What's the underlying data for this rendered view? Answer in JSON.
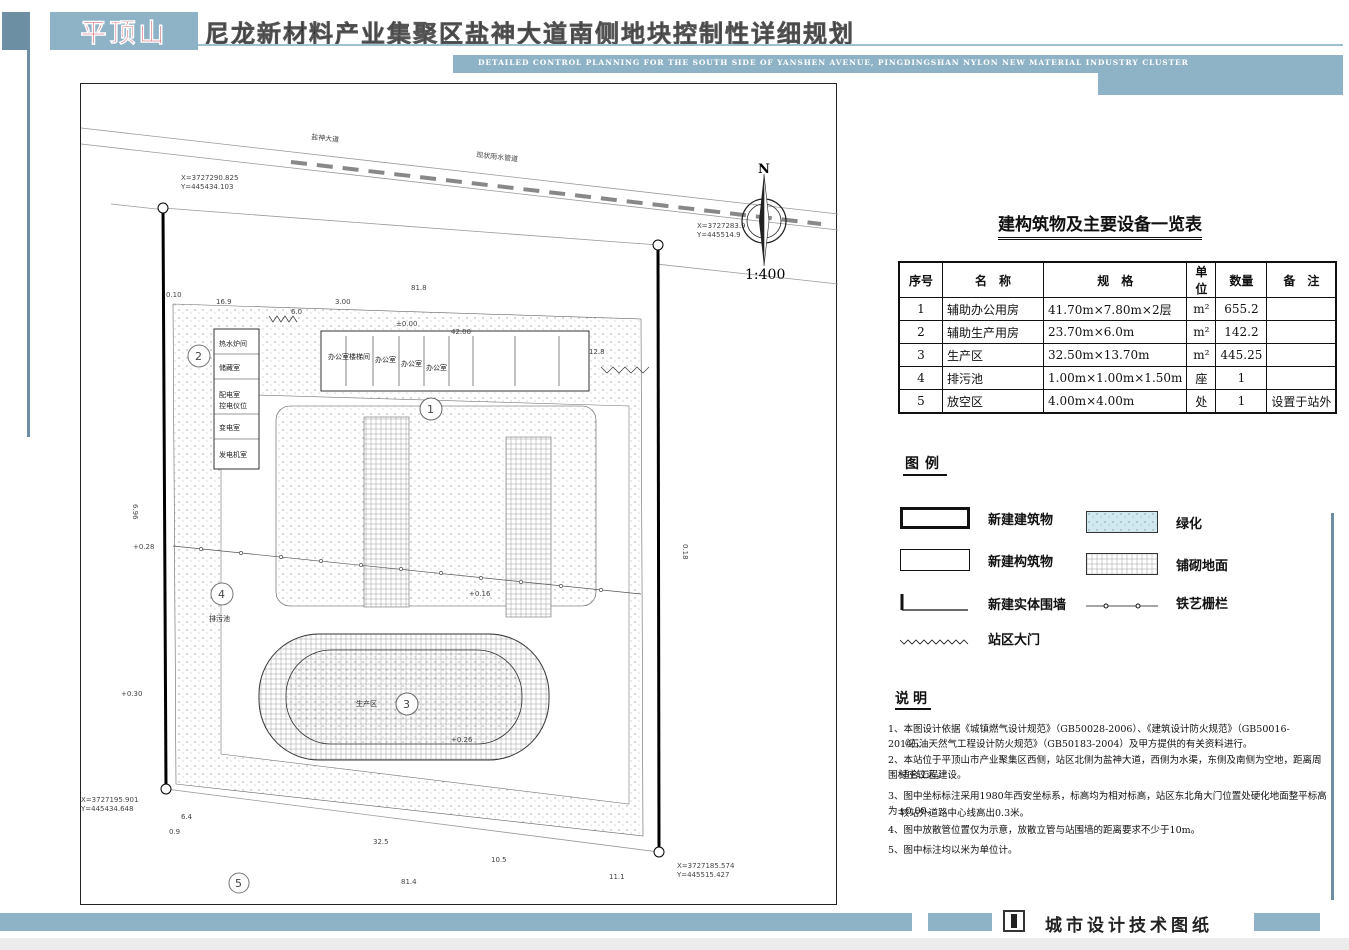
{
  "header": {
    "city": "平顶山",
    "title": "尼龙新材料产业集聚区盐神大道南侧地块控制性详细规划",
    "subtitle_en": "DETAILED CONTROL PLANNING FOR THE SOUTH SIDE OF YANSHEN AVENUE, PINGDINGSHAN NYLON NEW MATERIAL INDUSTRY CLUSTER"
  },
  "drawing": {
    "road_name": "盐神大道",
    "pipe_label": "现状雨水管道",
    "north": "N",
    "scale": "1:400",
    "coord_nw_x": "X=3727290.825",
    "coord_nw_y": "Y=445434.103",
    "coord_ne_x": "X=3727283.9",
    "coord_ne_y": "Y=445514.9",
    "coord_sw_x": "X=3727195.901",
    "coord_sw_y": "Y=445434.648",
    "coord_se_x": "X=3727185.574",
    "coord_se_y": "Y=445515.427",
    "rooms": [
      "热水炉间",
      "储藏室",
      "配电室",
      "控电仪位",
      "变电室",
      "发电机室"
    ],
    "office_rooms": [
      "办公室",
      "楼梯间",
      "办公室",
      "办公室",
      "办公室"
    ],
    "production_label": "生产区",
    "sewage_label": "排污池",
    "dims": {
      "top_total": "81.8",
      "d16_9": "16.9",
      "d6_0": "6.0",
      "d3_00": "3.00",
      "d42_00": "42.00",
      "d0_10": "0.10",
      "pm0_00": "±0.00",
      "d12_8": "12.8",
      "left_total": "6.96",
      "right_total": "0.18",
      "bottom_total": "81.4",
      "d6_4": "6.4",
      "d0_9": "0.9",
      "d32_5": "32.5",
      "d10_5": "10.5",
      "d11_1": "11.1",
      "d0_28": "+0.28",
      "d0_16": "+0.16",
      "d0_26": "+0.26",
      "d0_30": "+0.30"
    }
  },
  "table": {
    "title": "建构筑物及主要设备一览表",
    "headers": [
      "序号",
      "名　称",
      "规　格",
      "单位",
      "数量",
      "备　注"
    ],
    "rows": [
      [
        "1",
        "辅助办公用房",
        "41.70m×7.80m×2层",
        "m²",
        "655.2",
        ""
      ],
      [
        "2",
        "辅助生产用房",
        "23.70m×6.0m",
        "m²",
        "142.2",
        ""
      ],
      [
        "3",
        "生产区",
        "32.50m×13.70m",
        "m²",
        "445.25",
        ""
      ],
      [
        "4",
        "排污池",
        "1.00m×1.00m×1.50m",
        "座",
        "1",
        ""
      ],
      [
        "5",
        "放空区",
        "4.00m×4.00m",
        "处",
        "1",
        "设置于站外"
      ]
    ]
  },
  "legend": {
    "title": "图例",
    "items": [
      "新建建筑物",
      "新建构筑物",
      "新建实体围墙",
      "站区大门",
      "绿化",
      "铺砌地面",
      "铁艺栅栏"
    ]
  },
  "notes": {
    "title": "说明",
    "lines": [
      "1、本图设计依据《城镇燃气设计规范》（GB50028-2006）、《建筑设计防火规范》（GB50016-2014）、",
      "《石油天然气工程设计防火规范》（GB50183-2004）及甲方提供的有关资料进行。",
      "2、本站位于平顶山市产业聚集区西侧，站区北侧为盐神大道，西侧为水渠，东侧及南侧为空地，距离周围村庄较远，",
      "适合工程建设。",
      "3、图中坐标标注采用1980年西安坐标系，标高均为相对标高，站区东北角大门位置处硬化地面整平标高为±0.00，",
      "较站外道路中心线高出0.3米。",
      "4、图中放散管位置仅为示意，放散立管与站围墙的距离要求不少于10m。",
      "5、图中标注均以米为单位计。"
    ]
  },
  "footer": {
    "label": "城市设计技术图纸"
  }
}
